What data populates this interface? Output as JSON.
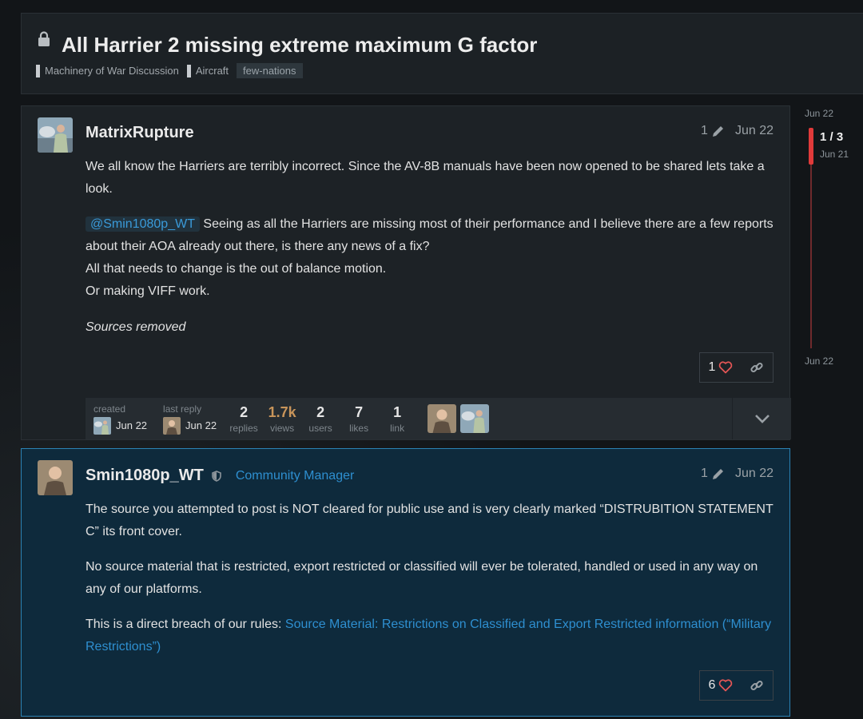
{
  "topic": {
    "title": "All Harrier 2 missing extreme maximum G factor",
    "categories": [
      "Machinery of War Discussion",
      "Aircraft"
    ],
    "tag": "few-nations"
  },
  "post1": {
    "username": "MatrixRupture",
    "edit_count": "1",
    "date": "Jun 22",
    "p1": "We all know the Harriers are terribly incorrect. Since the AV-8B manuals have been now opened to be shared lets take a look.",
    "mention": "@Smin1080p_WT",
    "p2": "Seeing as all the Harriers are missing most of their performance and I believe there are a few reports about their AOA already out there, is there any news of a fix?",
    "p3": "All that needs to change is the out of balance motion.",
    "p4": "Or making VIFF work.",
    "p5": "Sources removed",
    "likes": "1",
    "icons": {
      "edit": "pencil-icon",
      "like": "heart-icon",
      "link": "link-icon"
    }
  },
  "summary": {
    "created_label": "created",
    "created_date": "Jun 22",
    "last_reply_label": "last reply",
    "last_reply_date": "Jun 22",
    "stats": [
      {
        "num": "2",
        "label": "replies"
      },
      {
        "num": "1.7k",
        "label": "views"
      },
      {
        "num": "2",
        "label": "users"
      },
      {
        "num": "7",
        "label": "likes"
      },
      {
        "num": "1",
        "label": "link"
      }
    ]
  },
  "post2": {
    "username": "Smin1080p_WT",
    "role": "Community Manager",
    "edit_count": "1",
    "date": "Jun 22",
    "p1": "The source you attempted to post is NOT cleared for public use and is very clearly marked “DISTRUBITION STATEMENT C” its front cover.",
    "p2": "No source material that is restricted, export restricted or classified will ever be tolerated, handled or used in any way on any of our platforms.",
    "p3_prefix": "This is a direct breach of our rules: ",
    "p3_link": "Source Material: Restrictions on Classified and Export Restricted information (“Military Restrictions”)",
    "likes": "6"
  },
  "timeline": {
    "top_date": "Jun 22",
    "position": "1 / 3",
    "position_date": "Jun 21",
    "bottom_date": "Jun 22"
  },
  "colors": {
    "accent": "#2e8fd0",
    "views_hot": "#c9955a",
    "timeline_handle": "#e13a3a",
    "like_heart": "#e45656"
  }
}
